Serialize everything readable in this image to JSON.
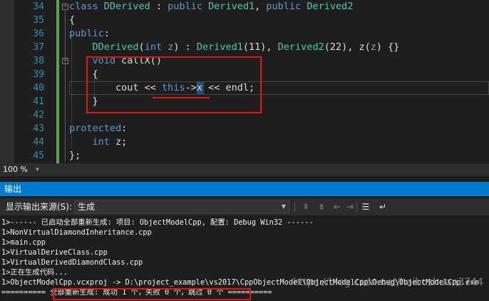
{
  "editor": {
    "line_numbers": [
      "34",
      "35",
      "36",
      "37",
      "38",
      "39",
      "40",
      "41",
      "42",
      "43",
      "44",
      "45"
    ],
    "lines": [
      [
        {
          "t": "class ",
          "c": "kw"
        },
        {
          "t": "DDerived",
          "c": "ty"
        },
        {
          "t": " : ",
          "c": ""
        },
        {
          "t": "public ",
          "c": "kw"
        },
        {
          "t": "Derived1",
          "c": "ty"
        },
        {
          "t": ", ",
          "c": ""
        },
        {
          "t": "public ",
          "c": "kw"
        },
        {
          "t": "Derived2",
          "c": "ty"
        }
      ],
      [
        {
          "t": "{",
          "c": ""
        }
      ],
      [
        {
          "t": "public",
          "c": "kw"
        },
        {
          "t": ":",
          "c": ""
        }
      ],
      [
        {
          "t": "    DDerived",
          "c": "ty"
        },
        {
          "t": "(",
          "c": ""
        },
        {
          "t": "int ",
          "c": "kw"
        },
        {
          "t": "z",
          "c": "pm"
        },
        {
          "t": ") : ",
          "c": ""
        },
        {
          "t": "Derived1",
          "c": "ty"
        },
        {
          "t": "(11), ",
          "c": ""
        },
        {
          "t": "Derived2",
          "c": "ty"
        },
        {
          "t": "(22), z(",
          "c": ""
        },
        {
          "t": "z",
          "c": "pm"
        },
        {
          "t": ") {}",
          "c": ""
        }
      ],
      [
        {
          "t": "    void ",
          "c": "kw"
        },
        {
          "t": "callX()",
          "c": ""
        }
      ],
      [
        {
          "t": "    {",
          "c": ""
        }
      ],
      [
        {
          "t": "        cout << ",
          "c": ""
        },
        {
          "t": "this",
          "c": "kw"
        },
        {
          "t": "->",
          "c": ""
        },
        {
          "t": "x",
          "c": ""
        },
        {
          "t": " << endl;",
          "c": ""
        }
      ],
      [
        {
          "t": "    }",
          "c": ""
        }
      ],
      [
        {
          "t": "",
          "c": ""
        }
      ],
      [
        {
          "t": "protected",
          "c": "kw"
        },
        {
          "t": ":",
          "c": ""
        }
      ],
      [
        {
          "t": "    int ",
          "c": "kw"
        },
        {
          "t": "z;",
          "c": ""
        }
      ],
      [
        {
          "t": "};",
          "c": ""
        }
      ]
    ]
  },
  "statusbar": {
    "zoom": "100 %"
  },
  "output_panel": {
    "title": "输出",
    "source_label": "显示输出来源(S):",
    "source_value": "生成",
    "lines": [
      "1>------ 已启动全部重新生成: 项目: ObjectModelCpp, 配置: Debug Win32 ------",
      "1>NonVirtualDiamondInheritance.cpp",
      "1>main.cpp",
      "1>VirtualDeriveClass.cpp",
      "1>VirtualDerivedDiamondClass.cpp",
      "1>正在生成代码...",
      "1>ObjectModelCpp.vcxproj -> D:\\project_example\\vs2017\\CppObjectModel\\ObjectModelCpp\\Debug\\ObjectModelCpp.exe",
      "========== 全部重新生成: 成功 1 个，失败 0 个，跳过 0 个 =========="
    ]
  },
  "watermark": "https://blog.csdn.net/haibozhuan3744",
  "colors": {
    "keyword": "#569cd6",
    "type": "#4ec9b0",
    "param": "#9a9a9a",
    "line_number": "#2b91af",
    "accent": "#007acc",
    "highlight": "#e51515"
  }
}
